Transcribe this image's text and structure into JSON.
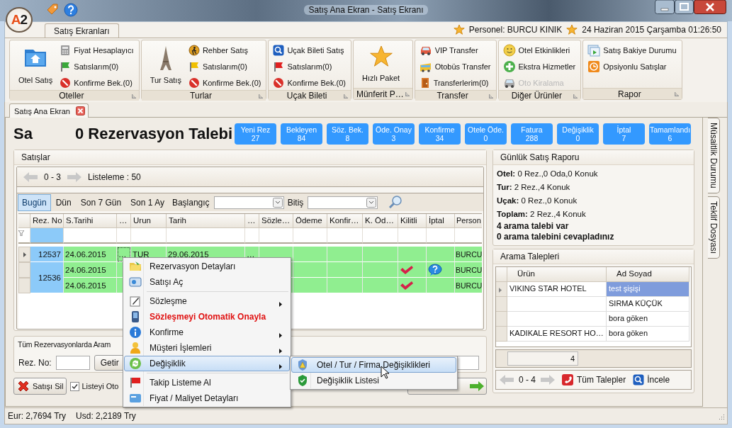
{
  "window": {
    "logo": "A2",
    "title": "Satış Ana Ekran - Satış Ekranı"
  },
  "ribbon": {
    "tabs": [
      {
        "label": "Satış Ekranları",
        "selected": true
      }
    ],
    "personnel": "Personel: BURCU KINIK",
    "datetime": "24 Haziran 2015 Çarşamba 01:26:50",
    "groups": [
      {
        "title": "Oteller",
        "large_button": "Otel Satış",
        "items": [
          {
            "label": "Fiyat Hesaplayıcı",
            "disabled": false
          },
          {
            "label": "Satıslarım(0)",
            "disabled": false
          },
          {
            "label": "Konfirme Bek.(0)",
            "disabled": false
          }
        ]
      },
      {
        "title": "Turlar",
        "large_button": "Tur Satış",
        "items": [
          {
            "label": "Rehber Satış",
            "disabled": false
          },
          {
            "label": "Satıslarım(0)",
            "disabled": false
          },
          {
            "label": "Konfirme Bek.(0)",
            "disabled": false
          }
        ]
      },
      {
        "title": "Uçak Bileti",
        "items": [
          {
            "label": "Uçak Bileti Satış",
            "disabled": false
          },
          {
            "label": "Satıslarım(0)",
            "disabled": false
          },
          {
            "label": "Konfirme Bek.(0)",
            "disabled": false
          }
        ]
      },
      {
        "title": "Münferit P…",
        "large_button": "Hızlı Paket"
      },
      {
        "title": "Transfer",
        "items": [
          {
            "label": "VIP Transfer",
            "disabled": false
          },
          {
            "label": "Otobüs Transfer",
            "disabled": false
          },
          {
            "label": "Transferlerim(0)",
            "disabled": false
          }
        ]
      },
      {
        "title": "Diğer Ürünler",
        "items": [
          {
            "label": "Otel Etkinlikleri",
            "disabled": false
          },
          {
            "label": "Ekstra Hizmetler",
            "disabled": false
          },
          {
            "label": "Oto Kiralama",
            "disabled": true
          }
        ]
      },
      {
        "title": "Rapor",
        "items": [
          {
            "label": "Satış Bakiye Durumu",
            "disabled": false
          },
          {
            "label": "Opsiyonlu Satışlar",
            "disabled": false
          }
        ]
      }
    ]
  },
  "doc_tabs": [
    {
      "label": "Satış Ana Ekran",
      "selected": true
    }
  ],
  "header": {
    "title_cut": "Sa",
    "title": "0 Rezervasyon Talebi"
  },
  "counters": [
    {
      "label": "Yeni Rez",
      "count": "27"
    },
    {
      "label": "Bekleyen",
      "count": "84"
    },
    {
      "label": "Söz. Bek.",
      "count": "8"
    },
    {
      "label": "Öde. Onay",
      "count": "3"
    },
    {
      "label": "Konfirme",
      "count": "34"
    },
    {
      "label": "Otele Öde.",
      "count": "0"
    },
    {
      "label": "Fatura",
      "count": "288"
    },
    {
      "label": "Değişiklik",
      "count": "0"
    },
    {
      "label": "İptal",
      "count": "7"
    },
    {
      "label": "Tamamlandı",
      "count": "6"
    }
  ],
  "sales": {
    "title": "Satışlar",
    "pager": {
      "range": "0 - 3",
      "listing": "Listeleme : 50"
    },
    "quick_filters": [
      {
        "label": "Bugün",
        "selected": true
      },
      {
        "label": "Dün",
        "selected": false
      },
      {
        "label": "Son 7 Gün",
        "selected": false
      },
      {
        "label": "Son 1 Ay",
        "selected": false
      }
    ],
    "start_label": "Başlangıç",
    "end_label": "Bitiş",
    "columns": [
      "Rez. No",
      "S.Tarihi",
      "…",
      "Urun",
      "Tarih",
      "…",
      "Sözle…",
      "Ödeme",
      "Konfir…",
      "K. Öd…",
      "Kilitli",
      "İptal",
      "Person"
    ],
    "rows": [
      {
        "rez_no": "12537",
        "selected": true,
        "lines": [
          {
            "cells": [
              "24.06.2015",
              "…",
              "TUR",
              "29.06.2015",
              "…"
            ],
            "personnel": "BURCU",
            "locked": false,
            "cancel_note": false
          }
        ]
      },
      {
        "rez_no": "12536",
        "selected": false,
        "lines": [
          {
            "cells": [
              "24.06.2015"
            ],
            "personnel": "BURCU",
            "locked": true,
            "cancel_note": true
          },
          {
            "cells": [
              "24.06.2015"
            ],
            "personnel": "BURCU",
            "locked": true,
            "cancel_note": false
          }
        ]
      }
    ]
  },
  "search": {
    "title": "Tüm Rezervasyonlarda Aram",
    "rez_label": "Rez. No:",
    "button": "Getir"
  },
  "actions": {
    "delete_button": "Satışı Sil",
    "auto_list": {
      "label": "Listeyi Oto",
      "checked": true
    }
  },
  "report": {
    "title": "Günlük Satış Raporu",
    "lines": [
      {
        "label": "Otel:",
        "value": "0 Rez.,0 Oda,0 Konuk"
      },
      {
        "label": "Tur:",
        "value": "2 Rez.,4 Konuk"
      },
      {
        "label": "Uçak:",
        "value": "0 Rez.,0 Konuk"
      },
      {
        "label": "Toplam:",
        "value": "2 Rez.,4 Konuk"
      }
    ],
    "notes": [
      "4 arama talebi var",
      "0 arama talebini cevapladınız"
    ]
  },
  "calls": {
    "title": "Arama Talepleri",
    "columns": [
      "Ürün",
      "Ad Soyad"
    ],
    "rows": [
      {
        "product": "VIKING STAR HOTEL",
        "name": "test şişişi",
        "selected": true
      },
      {
        "product": "",
        "name": "SIRMA KÜÇÜK",
        "selected": false
      },
      {
        "product": "",
        "name": "bora göken",
        "selected": false
      },
      {
        "product": "KADIKALE RESORT HO…",
        "name": "bora göken",
        "selected": false
      }
    ],
    "count": "4",
    "pager": "0 - 4",
    "buttons": [
      "Tüm Talepler",
      "İncele"
    ]
  },
  "side_tabs": [
    "Müsaitlik Durumu",
    "Teklif Dosyası"
  ],
  "status_bar": [
    "Eur: 2,7694 Try",
    "Usd: 2,2189 Try"
  ],
  "context_menu": {
    "sections": [
      [
        {
          "label": "Rezervasyon Detayları",
          "submenu": false,
          "alert": false,
          "selected": false
        },
        {
          "label": "Satışı Aç",
          "submenu": false,
          "alert": false,
          "selected": false
        }
      ],
      [
        {
          "label": "Sözleşme",
          "submenu": true,
          "alert": false,
          "selected": false
        },
        {
          "label": "Sözleşmeyi Otomatik Onayla",
          "submenu": false,
          "alert": true,
          "selected": false
        },
        {
          "label": "Konfirme",
          "submenu": true,
          "alert": false,
          "selected": false
        },
        {
          "label": "Müşteri İşlemleri",
          "submenu": true,
          "alert": false,
          "selected": false
        },
        {
          "label": "Değişiklik",
          "submenu": true,
          "alert": false,
          "selected": true
        }
      ],
      [
        {
          "label": "Takip Listeme Al",
          "submenu": false,
          "alert": false,
          "selected": false
        },
        {
          "label": "Fiyat / Maliyet Detayları",
          "submenu": false,
          "alert": false,
          "selected": false
        }
      ]
    ],
    "submenu": [
      {
        "label": "Otel / Tur / Firma Değişiklikleri",
        "selected": true
      },
      {
        "label": "Değişiklik Listesi",
        "selected": false
      }
    ]
  }
}
